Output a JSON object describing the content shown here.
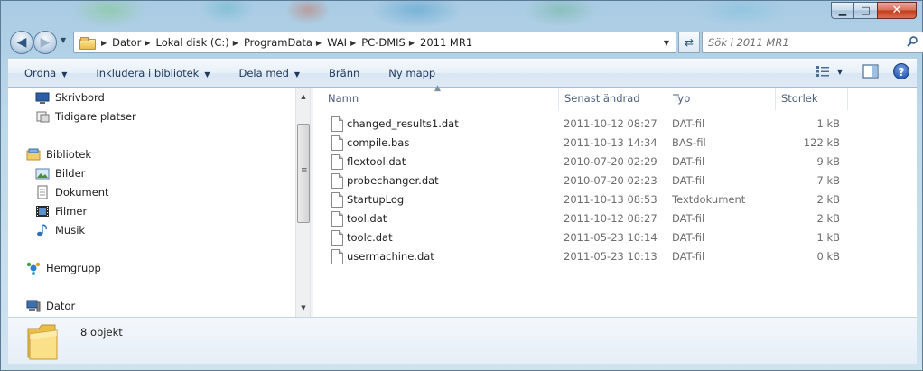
{
  "window": {
    "minimize_glyph": "▁",
    "maximize_glyph": "□",
    "close_glyph": "✕"
  },
  "navigation": {
    "back_glyph": "◀",
    "forward_glyph": "▶",
    "history_glyph": "▼",
    "breadcrumbs": [
      "Dator",
      "Lokal disk (C:)",
      "ProgramData",
      "WAI",
      "PC-DMIS",
      "2011 MR1"
    ],
    "refresh_glyph": "⇄"
  },
  "search": {
    "placeholder": "Sök i 2011 MR1",
    "icon": "search-icon"
  },
  "toolbar": {
    "organize_label": "Ordna",
    "include_label": "Inkludera i bibliotek",
    "share_label": "Dela med",
    "burn_label": "Bränn",
    "new_folder_label": "Ny mapp",
    "dropdown_glyph": "▼",
    "help_glyph": "?"
  },
  "sidebar": {
    "items": [
      {
        "label": "Skrivbord",
        "icon": "desktop-icon"
      },
      {
        "label": "Tidigare platser",
        "icon": "recent-places-icon"
      },
      {
        "label": "Bibliotek",
        "icon": "libraries-icon"
      },
      {
        "label": "Bilder",
        "icon": "pictures-icon"
      },
      {
        "label": "Dokument",
        "icon": "documents-icon"
      },
      {
        "label": "Filmer",
        "icon": "videos-icon"
      },
      {
        "label": "Musik",
        "icon": "music-icon"
      },
      {
        "label": "Hemgrupp",
        "icon": "homegroup-icon"
      },
      {
        "label": "Dator",
        "icon": "computer-icon"
      }
    ]
  },
  "filelist": {
    "columns": {
      "name": "Namn",
      "modified": "Senast ändrad",
      "type": "Typ",
      "size": "Storlek"
    },
    "sort_glyph": "▲",
    "rows": [
      {
        "name": "changed_results1.dat",
        "modified": "2011-10-12 08:27",
        "type": "DAT-fil",
        "size": "1 kB"
      },
      {
        "name": "compile.bas",
        "modified": "2011-10-13 14:34",
        "type": "BAS-fil",
        "size": "122 kB"
      },
      {
        "name": "flextool.dat",
        "modified": "2010-07-20 02:29",
        "type": "DAT-fil",
        "size": "9 kB"
      },
      {
        "name": "probechanger.dat",
        "modified": "2010-07-20 02:23",
        "type": "DAT-fil",
        "size": "7 kB"
      },
      {
        "name": "StartupLog",
        "modified": "2011-10-13 08:53",
        "type": "Textdokument",
        "size": "2 kB"
      },
      {
        "name": "tool.dat",
        "modified": "2011-10-12 08:27",
        "type": "DAT-fil",
        "size": "2 kB"
      },
      {
        "name": "toolc.dat",
        "modified": "2011-05-23 10:14",
        "type": "DAT-fil",
        "size": "1 kB"
      },
      {
        "name": "usermachine.dat",
        "modified": "2011-05-23 10:13",
        "type": "DAT-fil",
        "size": "0 kB"
      }
    ]
  },
  "details": {
    "count": "8 objekt"
  },
  "colors": {
    "frame": "#bcd8ea",
    "toolbar_text": "#1e395b",
    "header_text": "#4c607a",
    "secondary_text": "#6d6d6d",
    "folder_yellow": "#e9bd48"
  }
}
